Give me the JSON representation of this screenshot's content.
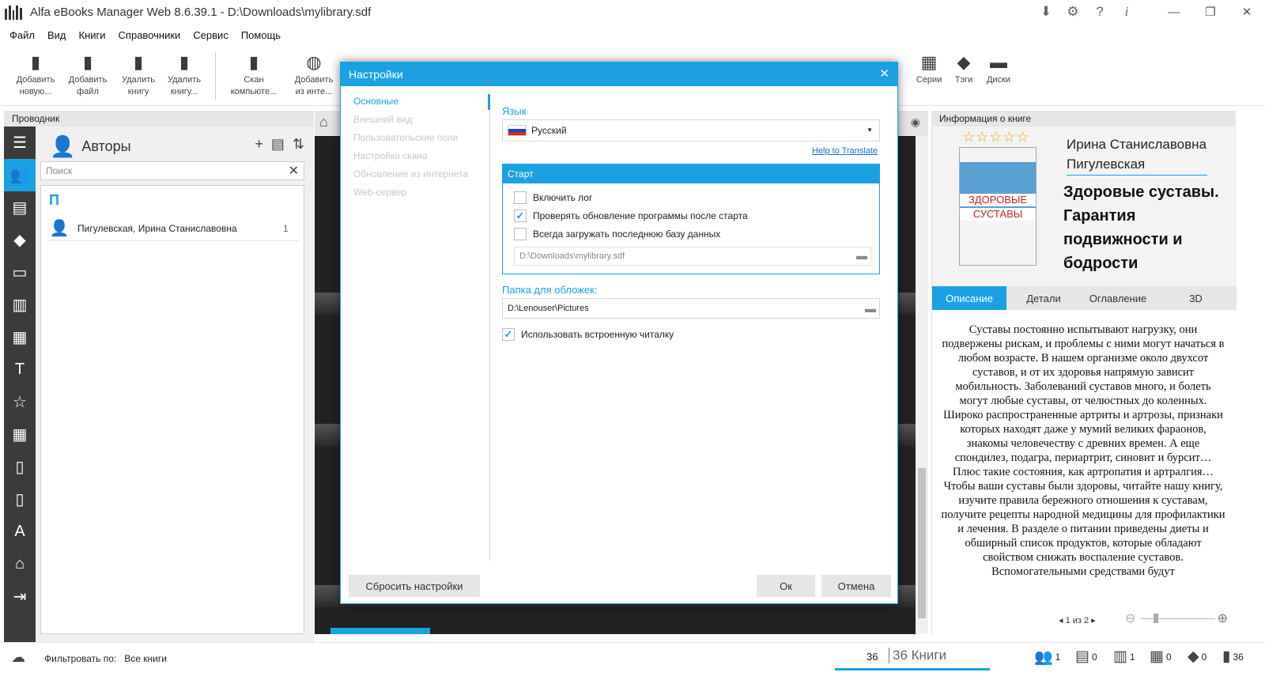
{
  "window": {
    "title": "Alfa eBooks Manager Web 8.6.39.1 - D:\\Downloads\\mylibrary.sdf",
    "icons": [
      "download-icon",
      "gear-icon",
      "help-icon",
      "info-icon"
    ],
    "controls": {
      "minimize": "—",
      "maximize": "❐",
      "close": "✕"
    }
  },
  "menu": [
    "Файл",
    "Вид",
    "Книги",
    "Справочники",
    "Сервис",
    "Помощь"
  ],
  "toolbar": {
    "add_new": "Добавить новую...",
    "add_file": "Добавить файл",
    "delete_book": "Удалить книгу",
    "delete_book2": "Удалить книгу...",
    "scan": "Скан компьюте...",
    "add_internet": "Добавить из инте...",
    "series": "Серии",
    "tags": "Тэги",
    "disks": "Диски"
  },
  "explorer": {
    "header": "Проводник",
    "title": "Авторы",
    "search_placeholder": "Поиск",
    "letter": "П",
    "authors": [
      {
        "name": "Пигулевская, Ирина Станиславовна",
        "count": "1"
      }
    ]
  },
  "dialog": {
    "title": "Настройки",
    "nav": [
      "Основные",
      "Внешний вид",
      "Пользовательские поля",
      "Настройки скана",
      "Обновление из интернета",
      "Web-сервер"
    ],
    "language_label": "Язык",
    "language_value": "Русский",
    "help_link": "Help to Translate",
    "start_label": "Старт",
    "checks": [
      {
        "label": "Включить лог",
        "checked": false
      },
      {
        "label": "Проверять обновление программы после старта",
        "checked": true
      },
      {
        "label": "Всегда загружать последнюю базу данных",
        "checked": false
      }
    ],
    "db_path": "D:\\Downloads\\mylibrary.sdf",
    "cover_folder_label": "Папка для обложек:",
    "cover_folder": "D:\\Lenouser\\Pictures",
    "builtin_reader": "Использовать встроенную читалку",
    "builtin_reader_checked": true,
    "reset_button": "Сбросить настройки",
    "ok_button": "Ок",
    "cancel_button": "Отмена"
  },
  "info": {
    "header": "Информация о книге",
    "author": "Ирина Станиславовна Пигулевская",
    "title": "Здоровые суставы. Гарантия подвижности и бодрости",
    "rating": 0,
    "cover_text_1": "ЗДОРОВЫЕ",
    "cover_text_2": "СУСТАВЫ",
    "tabs": [
      "Описание",
      "Детали",
      "Оглавление",
      "3D"
    ],
    "description_1": "Суставы постоянно испытывают нагрузку, они подвержены рискам, и проблемы с ними могут начаться в любом возрасте. В нашем организме около двухсот суставов, и от их здоровья напрямую зависит мобильность. Заболеваний суставов много, и болеть могут любые суставы, от челюстных до коленных. Широко распространенные артриты и артрозы, признаки которых находят даже у мумий великих фараонов, знакомы человечеству с древних времен. А еще спондилез, подагра, периартрит, синовит и бурсит… Плюс такие состояния, как артропатия и артралгия…",
    "description_2": "Чтобы ваши суставы были здоровы, читайте нашу книгу, изучите правила бережного отношения к суставам, получите рецепты народной медицины для профилактики и лечения. В разделе о питании приведены диеты и обширный список продуктов, которые обладают свойством снижать воспаление суставов. Вспомогательными средствами будут",
    "page_current": "1",
    "page_of": "из",
    "page_total": "2"
  },
  "status": {
    "filter_label": "Фильтровать по:",
    "filter_value": "Все книги",
    "count": "36",
    "books_label": "36 Книги",
    "authors": "1",
    "series": "0",
    "publishers": "1",
    "libraries": "0",
    "tags": "0",
    "files": "36"
  },
  "colors": {
    "accent": "#1ba1e2",
    "sidebar": "#3b3b3b",
    "link": "#1a6fc4"
  }
}
